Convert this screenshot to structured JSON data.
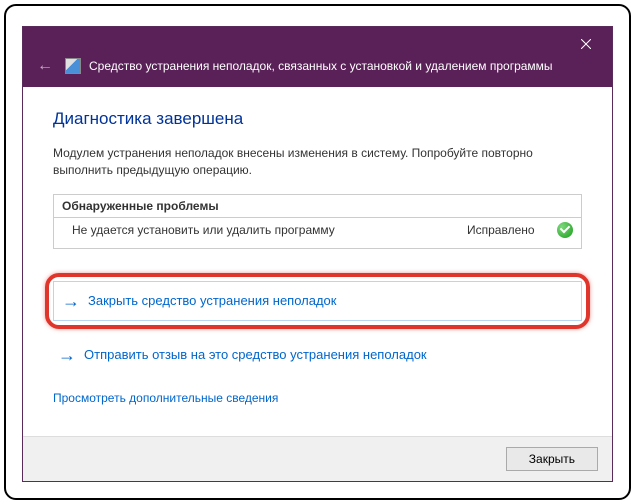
{
  "titlebar": {
    "title": "Средство устранения неполадок, связанных с установкой и удалением программы"
  },
  "content": {
    "heading": "Диагностика завершена",
    "description": "Модулем устранения неполадок внесены изменения в систему. Попробуйте повторно выполнить предыдущую операцию."
  },
  "problems": {
    "header": "Обнаруженные проблемы",
    "rows": [
      {
        "name": "Не удается установить или удалить программу",
        "status": "Исправлено"
      }
    ]
  },
  "actions": {
    "close_troubleshooter": "Закрыть средство устранения неполадок",
    "send_feedback": "Отправить отзыв на это средство устранения неполадок",
    "more_info": "Просмотреть дополнительные сведения"
  },
  "footer": {
    "close_button": "Закрыть"
  }
}
